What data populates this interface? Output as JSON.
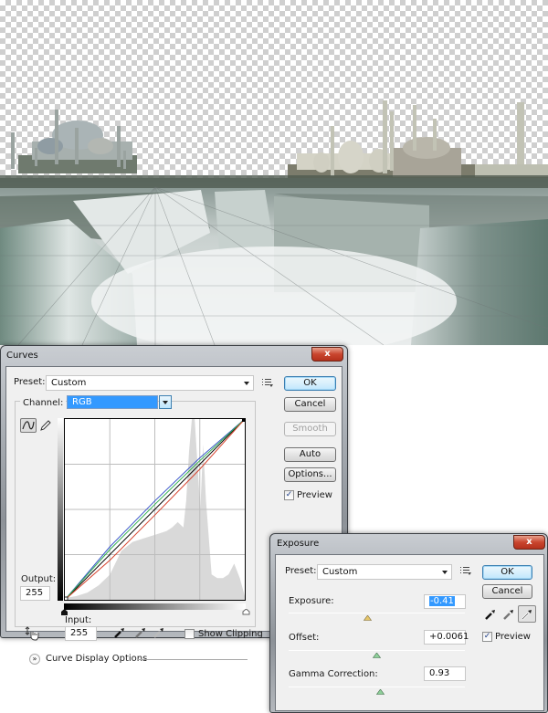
{
  "canvas": {
    "description": "Photoshop document: mosques skyline composited above waterfalls on transparent background"
  },
  "curves": {
    "title": "Curves",
    "close_label": "x",
    "preset_label": "Preset:",
    "preset_value": "Custom",
    "channel_label": "Channel:",
    "channel_value": "RGB",
    "output_label": "Output:",
    "output_value": "255",
    "input_label": "Input:",
    "input_value": "255",
    "show_clipping_label": "Show Clipping",
    "show_clipping_checked": false,
    "curve_display_options_label": "Curve Display Options",
    "buttons": {
      "ok": "OK",
      "cancel": "Cancel",
      "smooth": "Smooth",
      "auto": "Auto",
      "options": "Options..."
    },
    "preview_label": "Preview",
    "preview_checked": true,
    "chart_data": {
      "type": "line",
      "title": "",
      "xlabel": "Input",
      "ylabel": "Output",
      "xlim": [
        0,
        255
      ],
      "ylim": [
        0,
        255
      ],
      "grid": "4x4",
      "series": [
        {
          "name": "RGB",
          "color": "#000000",
          "x": [
            0,
            255
          ],
          "y": [
            0,
            255
          ]
        },
        {
          "name": "Blue",
          "color": "#3a56c9",
          "x": [
            0,
            64,
            128,
            191,
            255
          ],
          "y": [
            0,
            75,
            140,
            200,
            255
          ]
        },
        {
          "name": "Green",
          "color": "#2fae4f",
          "x": [
            0,
            64,
            128,
            191,
            255
          ],
          "y": [
            0,
            71,
            135,
            196,
            255
          ]
        },
        {
          "name": "Red",
          "color": "#d5412c",
          "x": [
            0,
            64,
            128,
            191,
            255
          ],
          "y": [
            0,
            56,
            120,
            184,
            255
          ]
        }
      ],
      "histogram": {
        "color": "#d9d9d9",
        "x": [
          0,
          16,
          32,
          48,
          64,
          80,
          96,
          112,
          128,
          144,
          152,
          160,
          168,
          172,
          176,
          180,
          184,
          188,
          192,
          196,
          200,
          208,
          216,
          224,
          232,
          240,
          248,
          255
        ],
        "y": [
          0.01,
          0.02,
          0.04,
          0.08,
          0.14,
          0.27,
          0.32,
          0.34,
          0.36,
          0.38,
          0.4,
          0.43,
          0.4,
          0.55,
          0.82,
          1.0,
          1.0,
          0.75,
          0.5,
          0.86,
          0.55,
          0.14,
          0.12,
          0.12,
          0.14,
          0.2,
          0.12,
          0.02
        ]
      }
    }
  },
  "exposure": {
    "title": "Exposure",
    "close_label": "x",
    "preset_label": "Preset:",
    "preset_value": "Custom",
    "exposure_label": "Exposure:",
    "exposure_value": "-0.41",
    "exposure_fraction": 0.45,
    "offset_label": "Offset:",
    "offset_value": "+0.0061",
    "offset_fraction": 0.5,
    "gamma_label": "Gamma Correction:",
    "gamma_value": "0.93",
    "gamma_fraction": 0.52,
    "buttons": {
      "ok": "OK",
      "cancel": "Cancel"
    },
    "preview_label": "Preview",
    "preview_checked": true,
    "colors": {
      "exposure_thumb": "#e6c66a",
      "slider_thumb": "#8fd09a",
      "selection": "#3399ff"
    }
  },
  "icons": {
    "check": "✓"
  }
}
